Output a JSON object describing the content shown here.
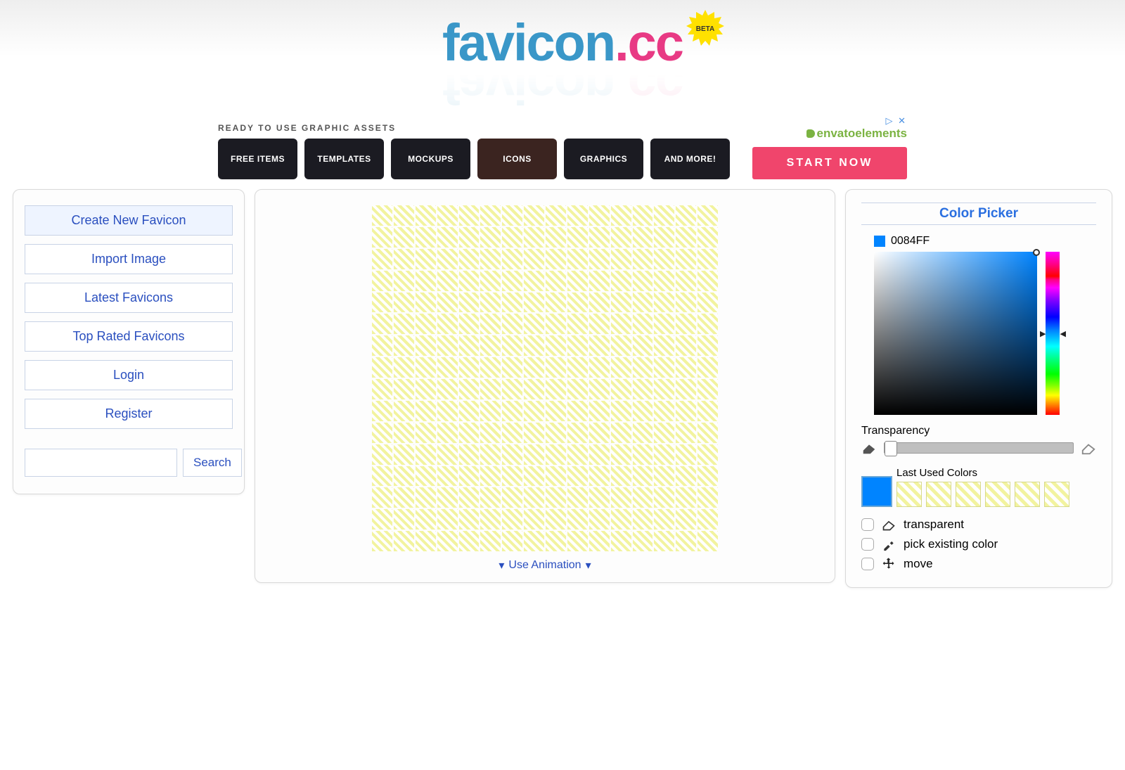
{
  "logo": {
    "word1": "favicon",
    "dot": ".",
    "word2": "cc",
    "badge": "BETA"
  },
  "ad": {
    "heading": "READY TO USE GRAPHIC ASSETS",
    "tiles": [
      "FREE ITEMS",
      "TEMPLATES",
      "MOCKUPS",
      "ICONS",
      "GRAPHICS",
      "AND MORE!"
    ],
    "brand": "envatoelements",
    "cta": "START NOW",
    "markers": "▷ ✕"
  },
  "sidebar": {
    "items": [
      "Create New Favicon",
      "Import Image",
      "Latest Favicons",
      "Top Rated Favicons",
      "Login",
      "Register"
    ],
    "search_label": "Search"
  },
  "canvas": {
    "grid_size": 16,
    "use_animation": "Use Animation"
  },
  "picker": {
    "title": "Color Picker",
    "current_hex": "0084FF",
    "transparency_label": "Transparency",
    "last_used_label": "Last Used Colors",
    "last_used_count": 6,
    "tools": [
      {
        "key": "transparent",
        "label": "transparent",
        "icon": "eraser"
      },
      {
        "key": "pick",
        "label": "pick existing color",
        "icon": "eyedropper"
      },
      {
        "key": "move",
        "label": "move",
        "icon": "move"
      }
    ]
  }
}
